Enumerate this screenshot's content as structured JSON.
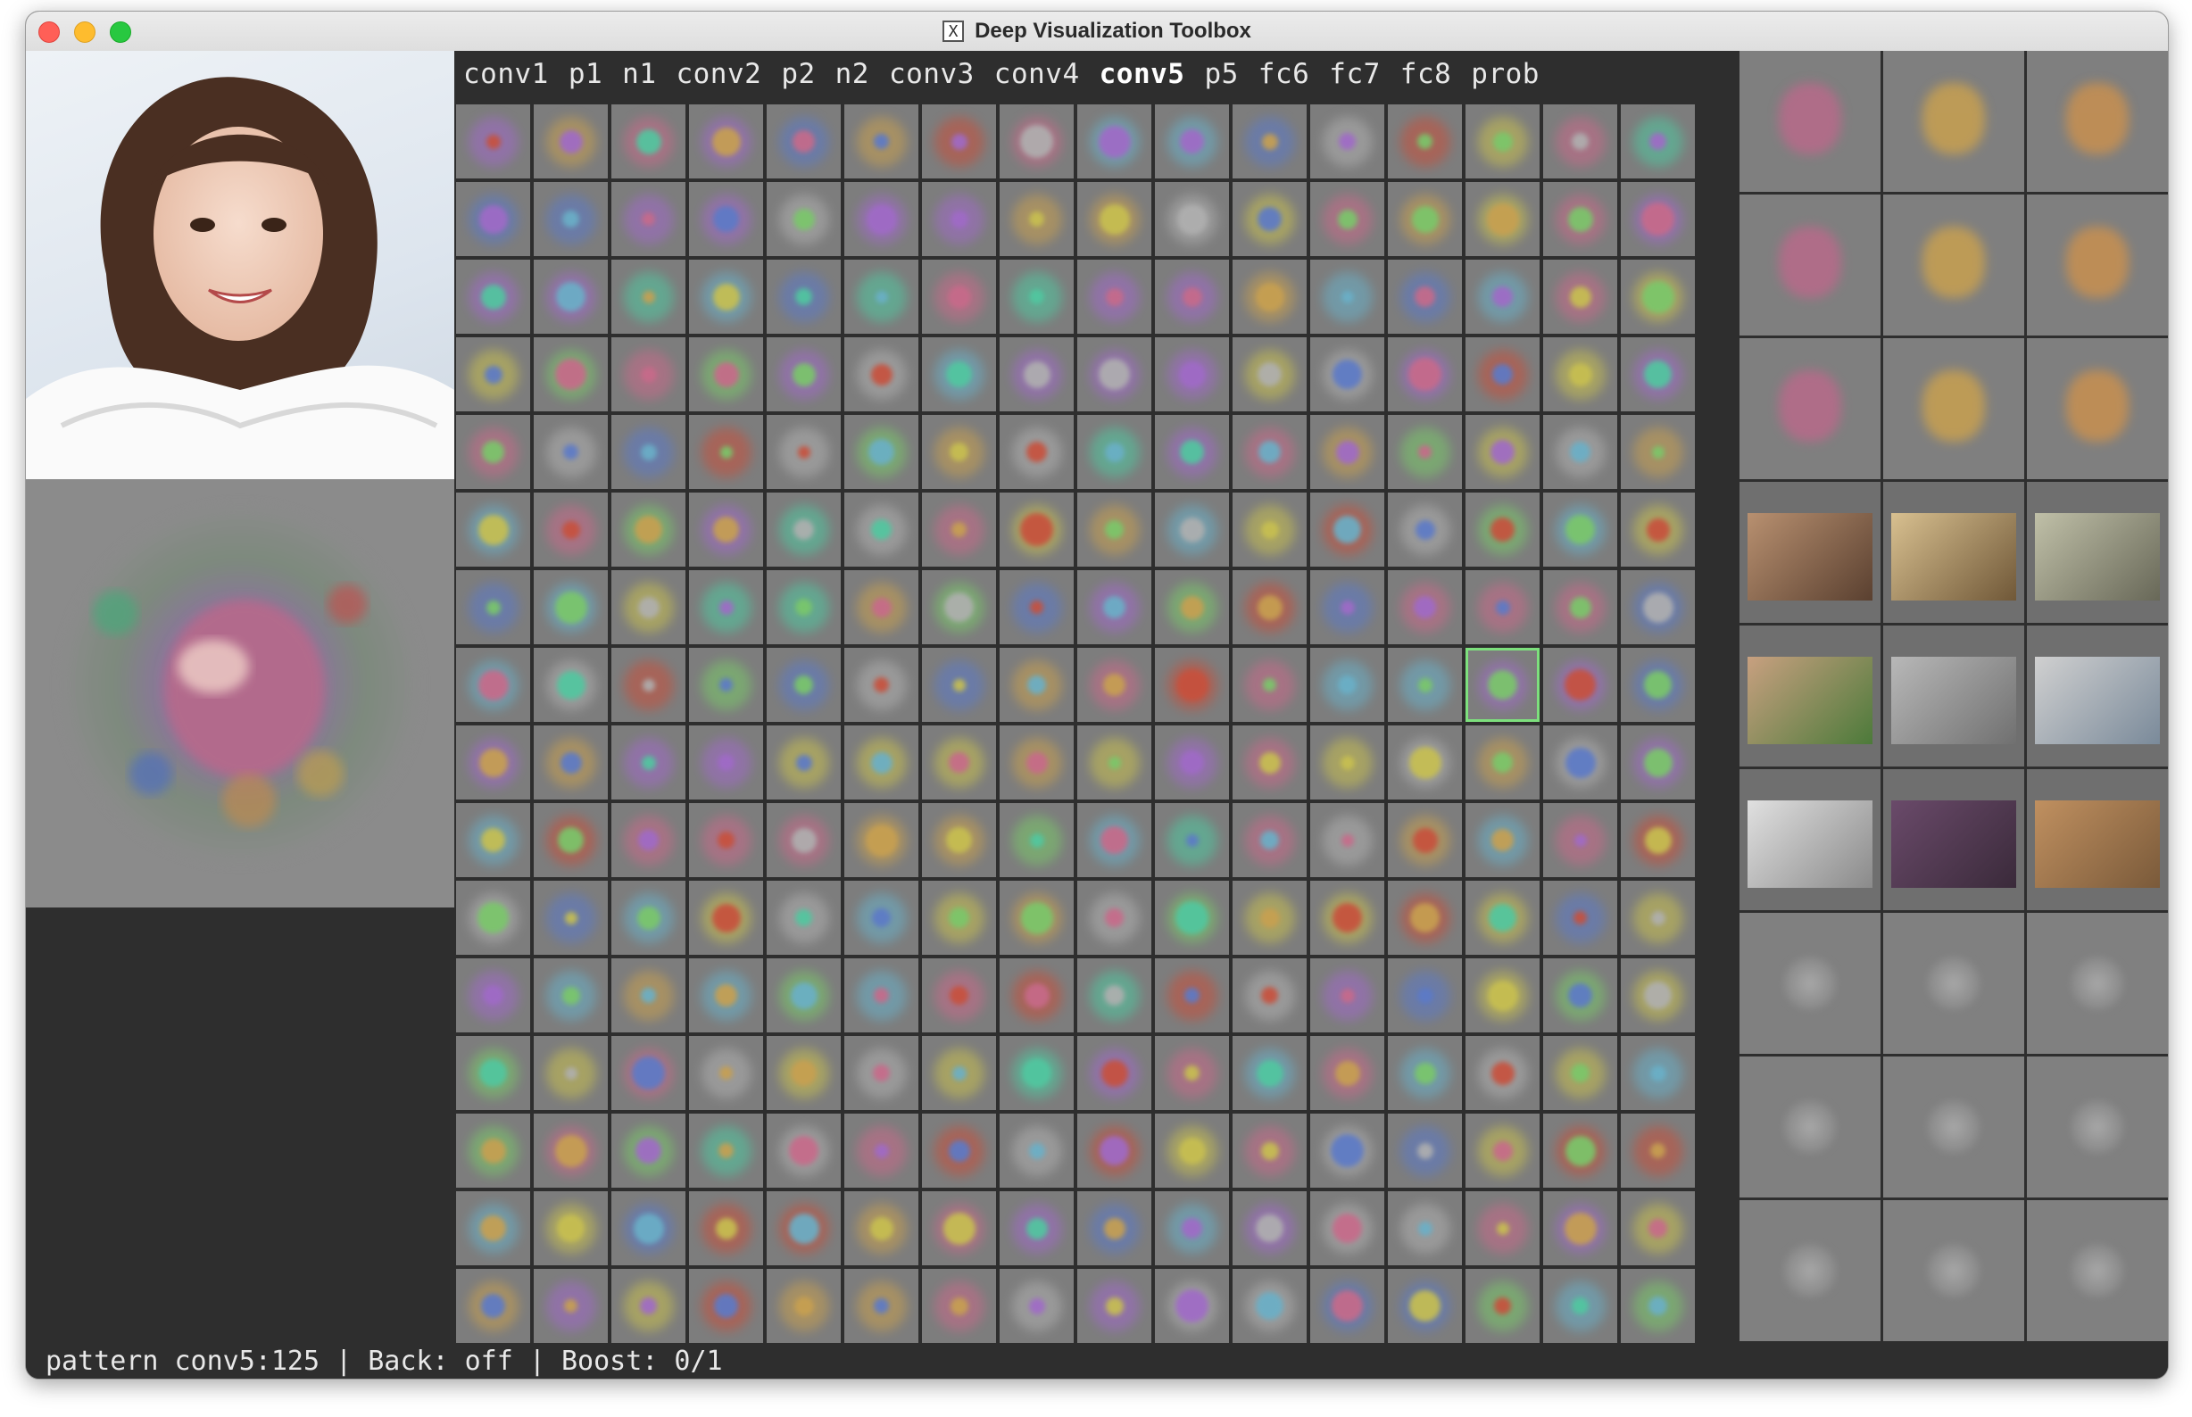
{
  "window": {
    "title": "Deep Visualization Toolbox",
    "app_icon": "x11-icon"
  },
  "layers": {
    "items": [
      "conv1",
      "p1",
      "n1",
      "conv2",
      "p2",
      "n2",
      "conv3",
      "conv4",
      "conv5",
      "p5",
      "fc6",
      "fc7",
      "fc8",
      "prob"
    ],
    "active": "conv5"
  },
  "grid": {
    "rows": 16,
    "cols": 16,
    "selected_row": 7,
    "selected_col": 13
  },
  "right_panel": {
    "sections": [
      "top-optimized-images",
      "top-activating-images",
      "deconvolution-images"
    ]
  },
  "status": {
    "text": "pattern conv5:125 | Back: off | Boost: 0/1"
  },
  "colors": {
    "window_bg": "#2e2e2e",
    "cell_bg": "#7d7d7d",
    "selected_outline": "#7de07d",
    "text": "#e8e8e8"
  }
}
